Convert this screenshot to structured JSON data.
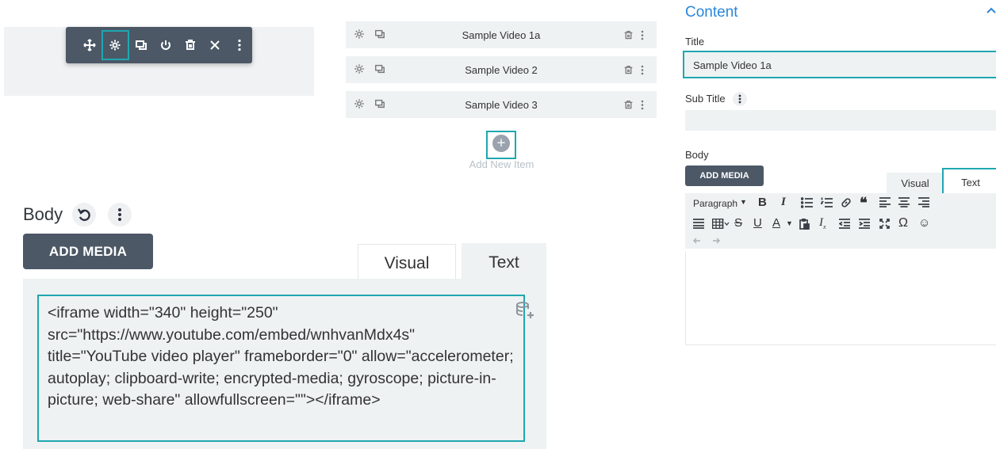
{
  "module_toolbar": {
    "icons": [
      "move-icon",
      "gear-icon",
      "duplicate-icon",
      "power-icon",
      "trash-icon",
      "close-icon",
      "more-icon"
    ]
  },
  "items": [
    {
      "title": "Sample Video 1a"
    },
    {
      "title": "Sample Video 2"
    },
    {
      "title": "Sample Video 3"
    }
  ],
  "add_item": {
    "plus": "+",
    "label": "Add New Item"
  },
  "big_editor": {
    "label": "Body",
    "add_media": "ADD MEDIA",
    "tab_visual": "Visual",
    "tab_text": "Text",
    "content": "<iframe width=\"340\" height=\"250\" src=\"https://www.youtube.com/embed/wnhvanMdx4s\" title=\"YouTube video player\" frameborder=\"0\" allow=\"accelerometer; autoplay; clipboard-write; encrypted-media; gyroscope; picture-in-picture; web-share\" allowfullscreen=\"\"></iframe>"
  },
  "panel": {
    "heading": "Content",
    "title_label": "Title",
    "title_value": "Sample Video 1a",
    "subtitle_label": "Sub Title",
    "body_label": "Body",
    "add_media": "ADD MEDIA",
    "tab_visual": "Visual",
    "tab_text": "Text",
    "format_select": "Paragraph"
  },
  "colors": {
    "accent": "#1fa7b0",
    "toolbar": "#4c5866",
    "heading": "#2b87da"
  }
}
